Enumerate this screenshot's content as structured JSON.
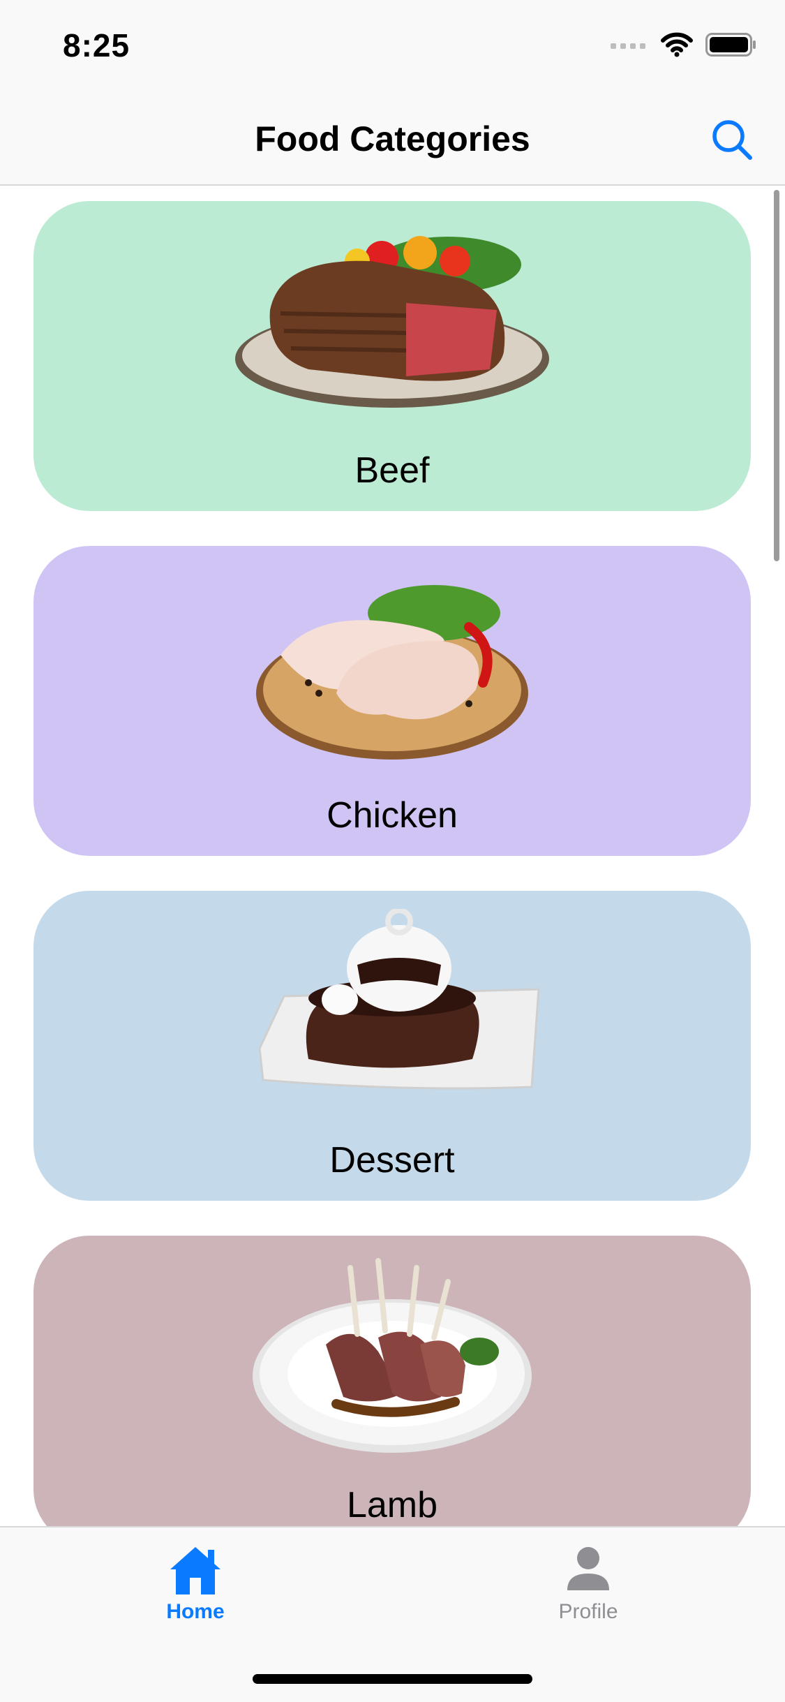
{
  "status_bar": {
    "time": "8:25"
  },
  "nav": {
    "title": "Food Categories",
    "search_icon": "search-icon"
  },
  "categories": [
    {
      "label": "Beef",
      "color": "#bcebd4"
    },
    {
      "label": "Chicken",
      "color": "#d0c4f5"
    },
    {
      "label": "Dessert",
      "color": "#c4d9ea"
    },
    {
      "label": "Lamb",
      "color": "#ccb4b9"
    }
  ],
  "tabs": [
    {
      "label": "Home",
      "icon": "home-icon",
      "active": true
    },
    {
      "label": "Profile",
      "icon": "person-icon",
      "active": false
    }
  ],
  "colors": {
    "accent": "#0a7aff",
    "inactive": "#8e8e93"
  }
}
